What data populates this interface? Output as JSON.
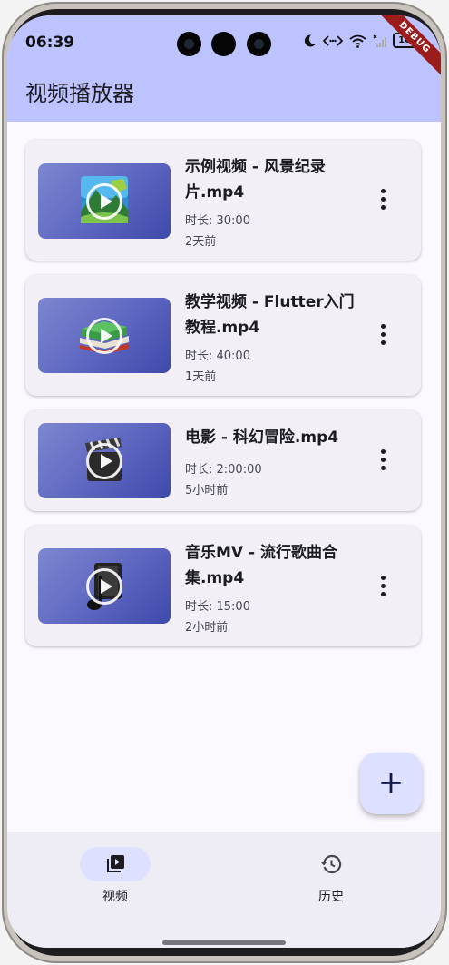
{
  "status_bar": {
    "time": "06:39",
    "battery": "100"
  },
  "debug_banner": "DEBUG",
  "app_bar": {
    "title": "视频播放器"
  },
  "videos": [
    {
      "title": "示例视频 - 风景纪录片.mp4",
      "duration": "时长: 30:00",
      "time_ago": "2天前",
      "thumbnail_icon": "landscape-icon"
    },
    {
      "title": "教学视频 - Flutter入门教程.mp4",
      "duration": "时长: 40:00",
      "time_ago": "1天前",
      "thumbnail_icon": "books-icon"
    },
    {
      "title": "电影 - 科幻冒险.mp4",
      "duration": "时长: 2:00:00",
      "time_ago": "5小时前",
      "thumbnail_icon": "clapperboard-icon"
    },
    {
      "title": "音乐MV - 流行歌曲合集.mp4",
      "duration": "时长: 15:00",
      "time_ago": "2小时前",
      "thumbnail_icon": "music-note-icon"
    }
  ],
  "fab": {
    "icon": "add-icon",
    "label": "+"
  },
  "bottom_nav": {
    "items": [
      {
        "label": "视频",
        "icon": "video-library-icon",
        "selected": true
      },
      {
        "label": "历史",
        "icon": "history-icon",
        "selected": false
      }
    ]
  },
  "colors": {
    "app_bar": "#bcc3fe",
    "background": "#fcf8ff",
    "card": "#f3eff7",
    "thumbnail_start": "#7d86cf",
    "thumbnail_end": "#3f49a8",
    "fab": "#dee0ff",
    "nav_background": "#eeecf5",
    "nav_indicator": "#dee0ff"
  }
}
